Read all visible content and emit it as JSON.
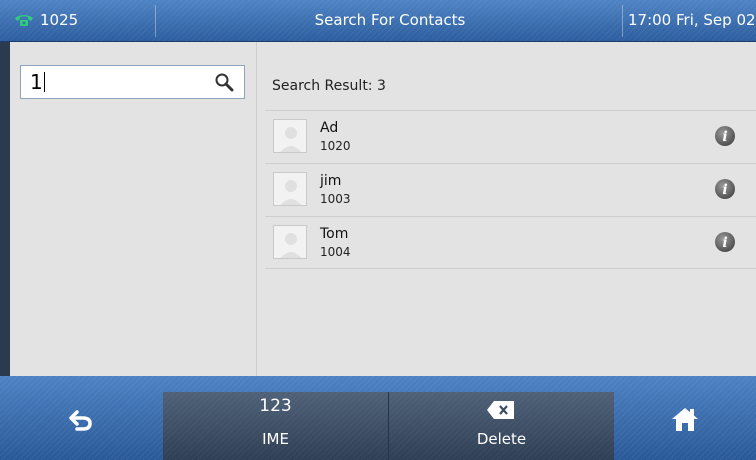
{
  "status_bar": {
    "account": "1025",
    "title": "Search For Contacts",
    "datetime": "17:00 Fri, Sep 02"
  },
  "search": {
    "value": "1",
    "placeholder": ""
  },
  "results": {
    "summary": "Search Result: 3",
    "contacts": [
      {
        "name": "Ad",
        "number": "1020"
      },
      {
        "name": "jim",
        "number": "1003"
      },
      {
        "name": "Tom",
        "number": "1004"
      }
    ]
  },
  "softkeys": {
    "ime_top": "123",
    "ime_label": "IME",
    "delete_label": "Delete"
  },
  "icons": {
    "account": "phone-handset-icon",
    "search": "search-icon",
    "info": "info-icon",
    "back": "back-arrow-icon",
    "backspace": "backspace-icon",
    "home": "home-icon"
  },
  "colors": {
    "bar_blue": "#3c6fb0",
    "softkey_dark": "#3d4d63",
    "phone_green": "#2ecf7a",
    "content_bg": "#e3e3e3"
  }
}
